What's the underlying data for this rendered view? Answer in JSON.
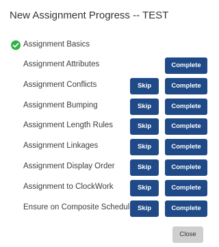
{
  "dialog": {
    "title": "New Assignment Progress -- TEST",
    "close_label": "Close"
  },
  "basics": {
    "label": "Assignment Basics",
    "status_icon": "check-circle-icon",
    "status_color": "#2fb344"
  },
  "buttons": {
    "skip_label": "Skip",
    "complete_label": "Complete",
    "button_color": "#1f4a87"
  },
  "steps": [
    {
      "label": "Assignment Attributes"
    },
    {
      "label": "Assignment Conflicts"
    },
    {
      "label": "Assignment Bumping"
    },
    {
      "label": "Assignment Length Rules"
    },
    {
      "label": "Assignment Linkages"
    },
    {
      "label": "Assignment Display Order"
    },
    {
      "label": "Assignment to ClockWork"
    },
    {
      "label": "Ensure on Composite Schedules"
    }
  ]
}
